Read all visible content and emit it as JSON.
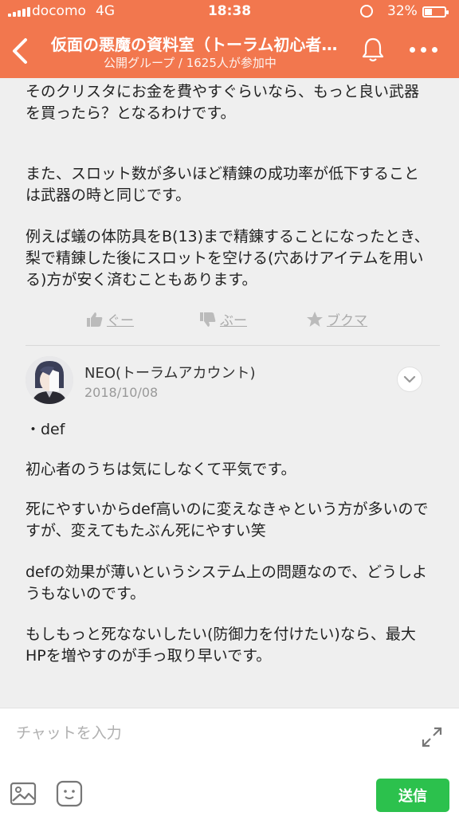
{
  "status_bar": {
    "carrier": "docomo",
    "network": "4G",
    "time": "18:38",
    "battery": "32%"
  },
  "header": {
    "title": "仮面の悪魔の資料室（トーラム初心者…",
    "subtitle": "公開グループ / 1625人が参加中",
    "color": "#f2774e"
  },
  "post_top": {
    "para1": "そのクリスタにお金を費やすぐらいなら、もっと良い武器を買ったら？となるわけです。",
    "para2": "また、スロット数が多いほど精錬の成功率が低下することは武器の時と同じです。",
    "para3": "例えば蟻の体防具をB(13)まで精錬することになったとき、梨で精錬した後にスロットを空ける(穴あけアイテムを用いる)方が安く済むこともあります。",
    "reactions": {
      "good": "ぐー",
      "boo": "ぶー",
      "bookmark": "ブクマ"
    }
  },
  "post": {
    "user_name": "NEO(トーラムアカウント)",
    "date": "2018/10/08",
    "line1": "・def",
    "line2": "初心者のうちは気にしなくて平気です。",
    "line3": "死にやすいからdef高いのに変えなきゃという方が多いのですが、変えてもたぶん死にやすい笑",
    "line4": "defの効果が薄いというシステム上の問題なので、どうしようもないのです。",
    "line5": "もしもっと死なないしたい(防御力を付けたい)なら、最大HPを増やすのが手っ取り早いです。"
  },
  "input_bar": {
    "placeholder": "チャットを入力",
    "send_label": "送信",
    "send_color": "#2cc14d"
  }
}
